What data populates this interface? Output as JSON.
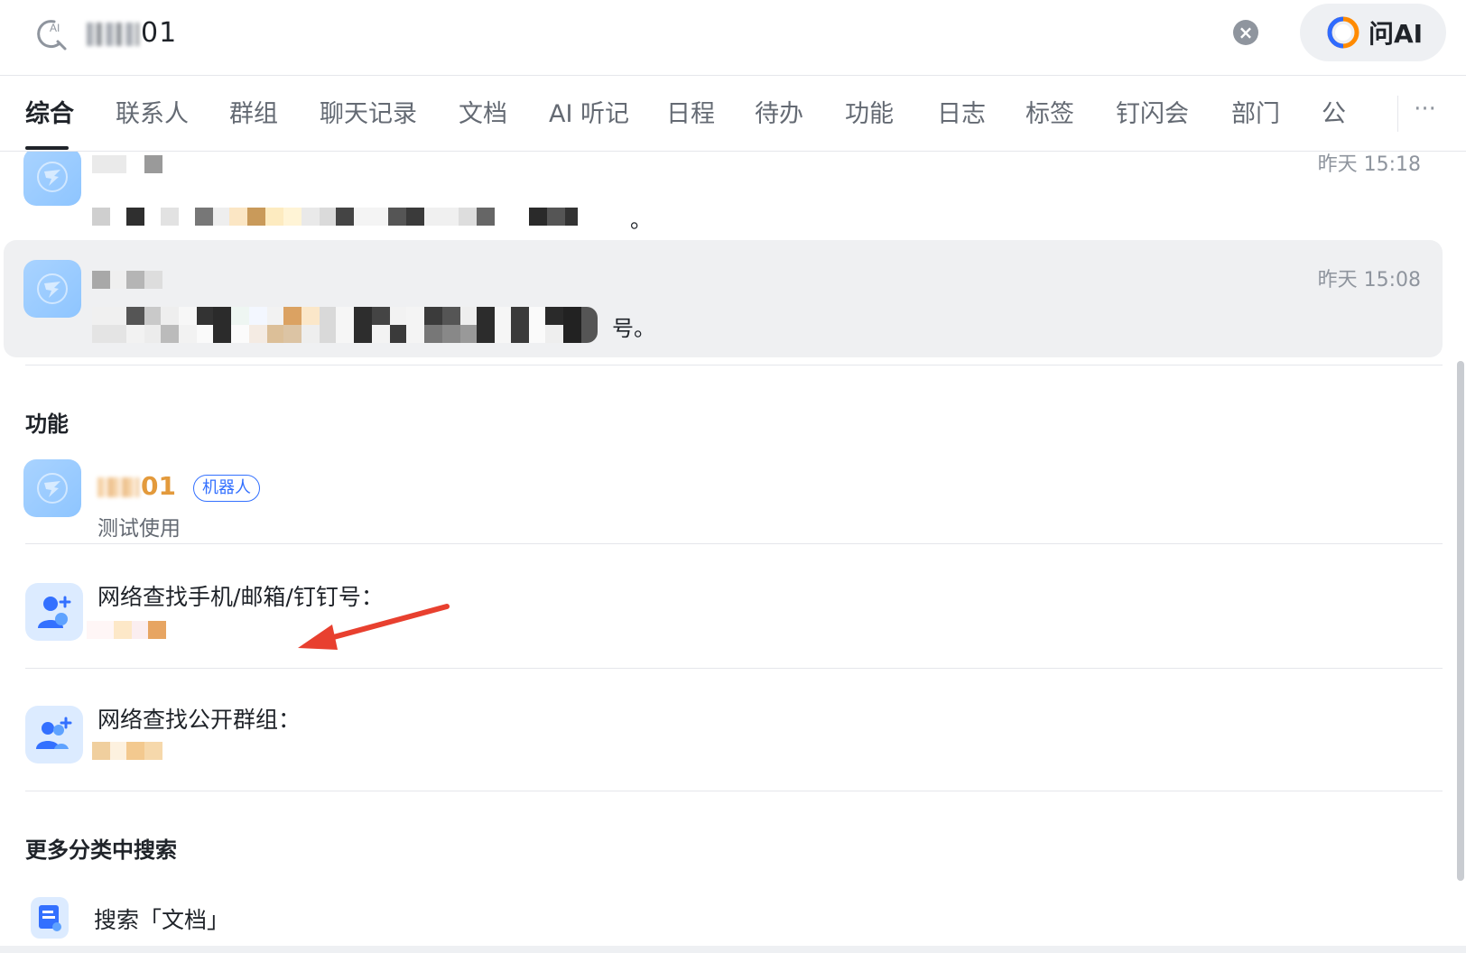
{
  "search": {
    "query_visible": "01",
    "clear_icon": "close-icon",
    "ask_ai_label": "问AI"
  },
  "tabs": [
    {
      "label": "综合",
      "active": true
    },
    {
      "label": "联系人"
    },
    {
      "label": "群组"
    },
    {
      "label": "聊天记录"
    },
    {
      "label": "文档"
    },
    {
      "label": "AI 听记"
    },
    {
      "label": "日程"
    },
    {
      "label": "待办"
    },
    {
      "label": "功能"
    },
    {
      "label": "日志"
    },
    {
      "label": "标签"
    },
    {
      "label": "钉闪会"
    },
    {
      "label": "部门"
    },
    {
      "label": "公"
    }
  ],
  "more_tabs_label": "···",
  "messages": [
    {
      "time": "昨天 15:18",
      "trailing": "。"
    },
    {
      "time": "昨天 15:08",
      "trailing": "号。"
    }
  ],
  "functions": {
    "section_title": "功能",
    "bot": {
      "name_visible": "01",
      "badge": "机器人",
      "subtitle": "测试使用"
    }
  },
  "network_find": {
    "contacts_label": "网络查找手机/邮箱/钉钉号：",
    "groups_label": "网络查找公开群组："
  },
  "more_categories": {
    "section_title": "更多分类中搜索",
    "items": [
      {
        "label": "搜索「文档」"
      }
    ]
  },
  "colors": {
    "accent_blue": "#3370ff",
    "bot_name": "#e39a3c",
    "annotation_arrow": "#e8402f"
  }
}
